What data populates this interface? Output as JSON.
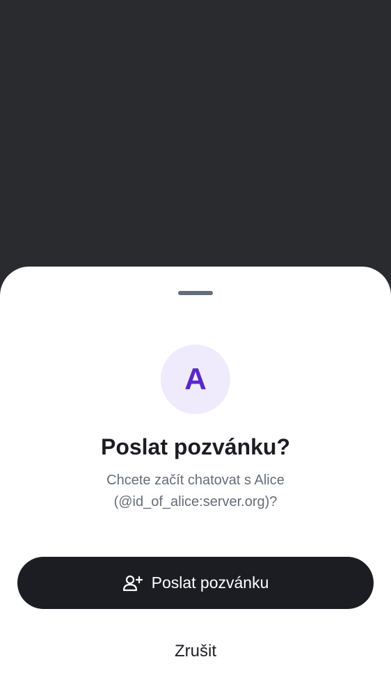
{
  "sheet": {
    "avatar_initial": "A",
    "title": "Poslat pozvánku?",
    "subtitle_line1": "Chcete začít chatovat s Alice",
    "subtitle_line2": "(@id_of_alice:server.org)?",
    "primary_button": {
      "label": "Poslat pozvánku",
      "icon": "add-person-icon"
    },
    "cancel_label": "Zrušit"
  },
  "colors": {
    "backdrop": "#2a2b2e",
    "sheet_background": "#ffffff",
    "avatar_background": "#efebfc",
    "avatar_text": "#5a27c9",
    "primary_button": "#1b1d22",
    "text_primary": "#1b1d22",
    "text_secondary": "#656d77"
  }
}
